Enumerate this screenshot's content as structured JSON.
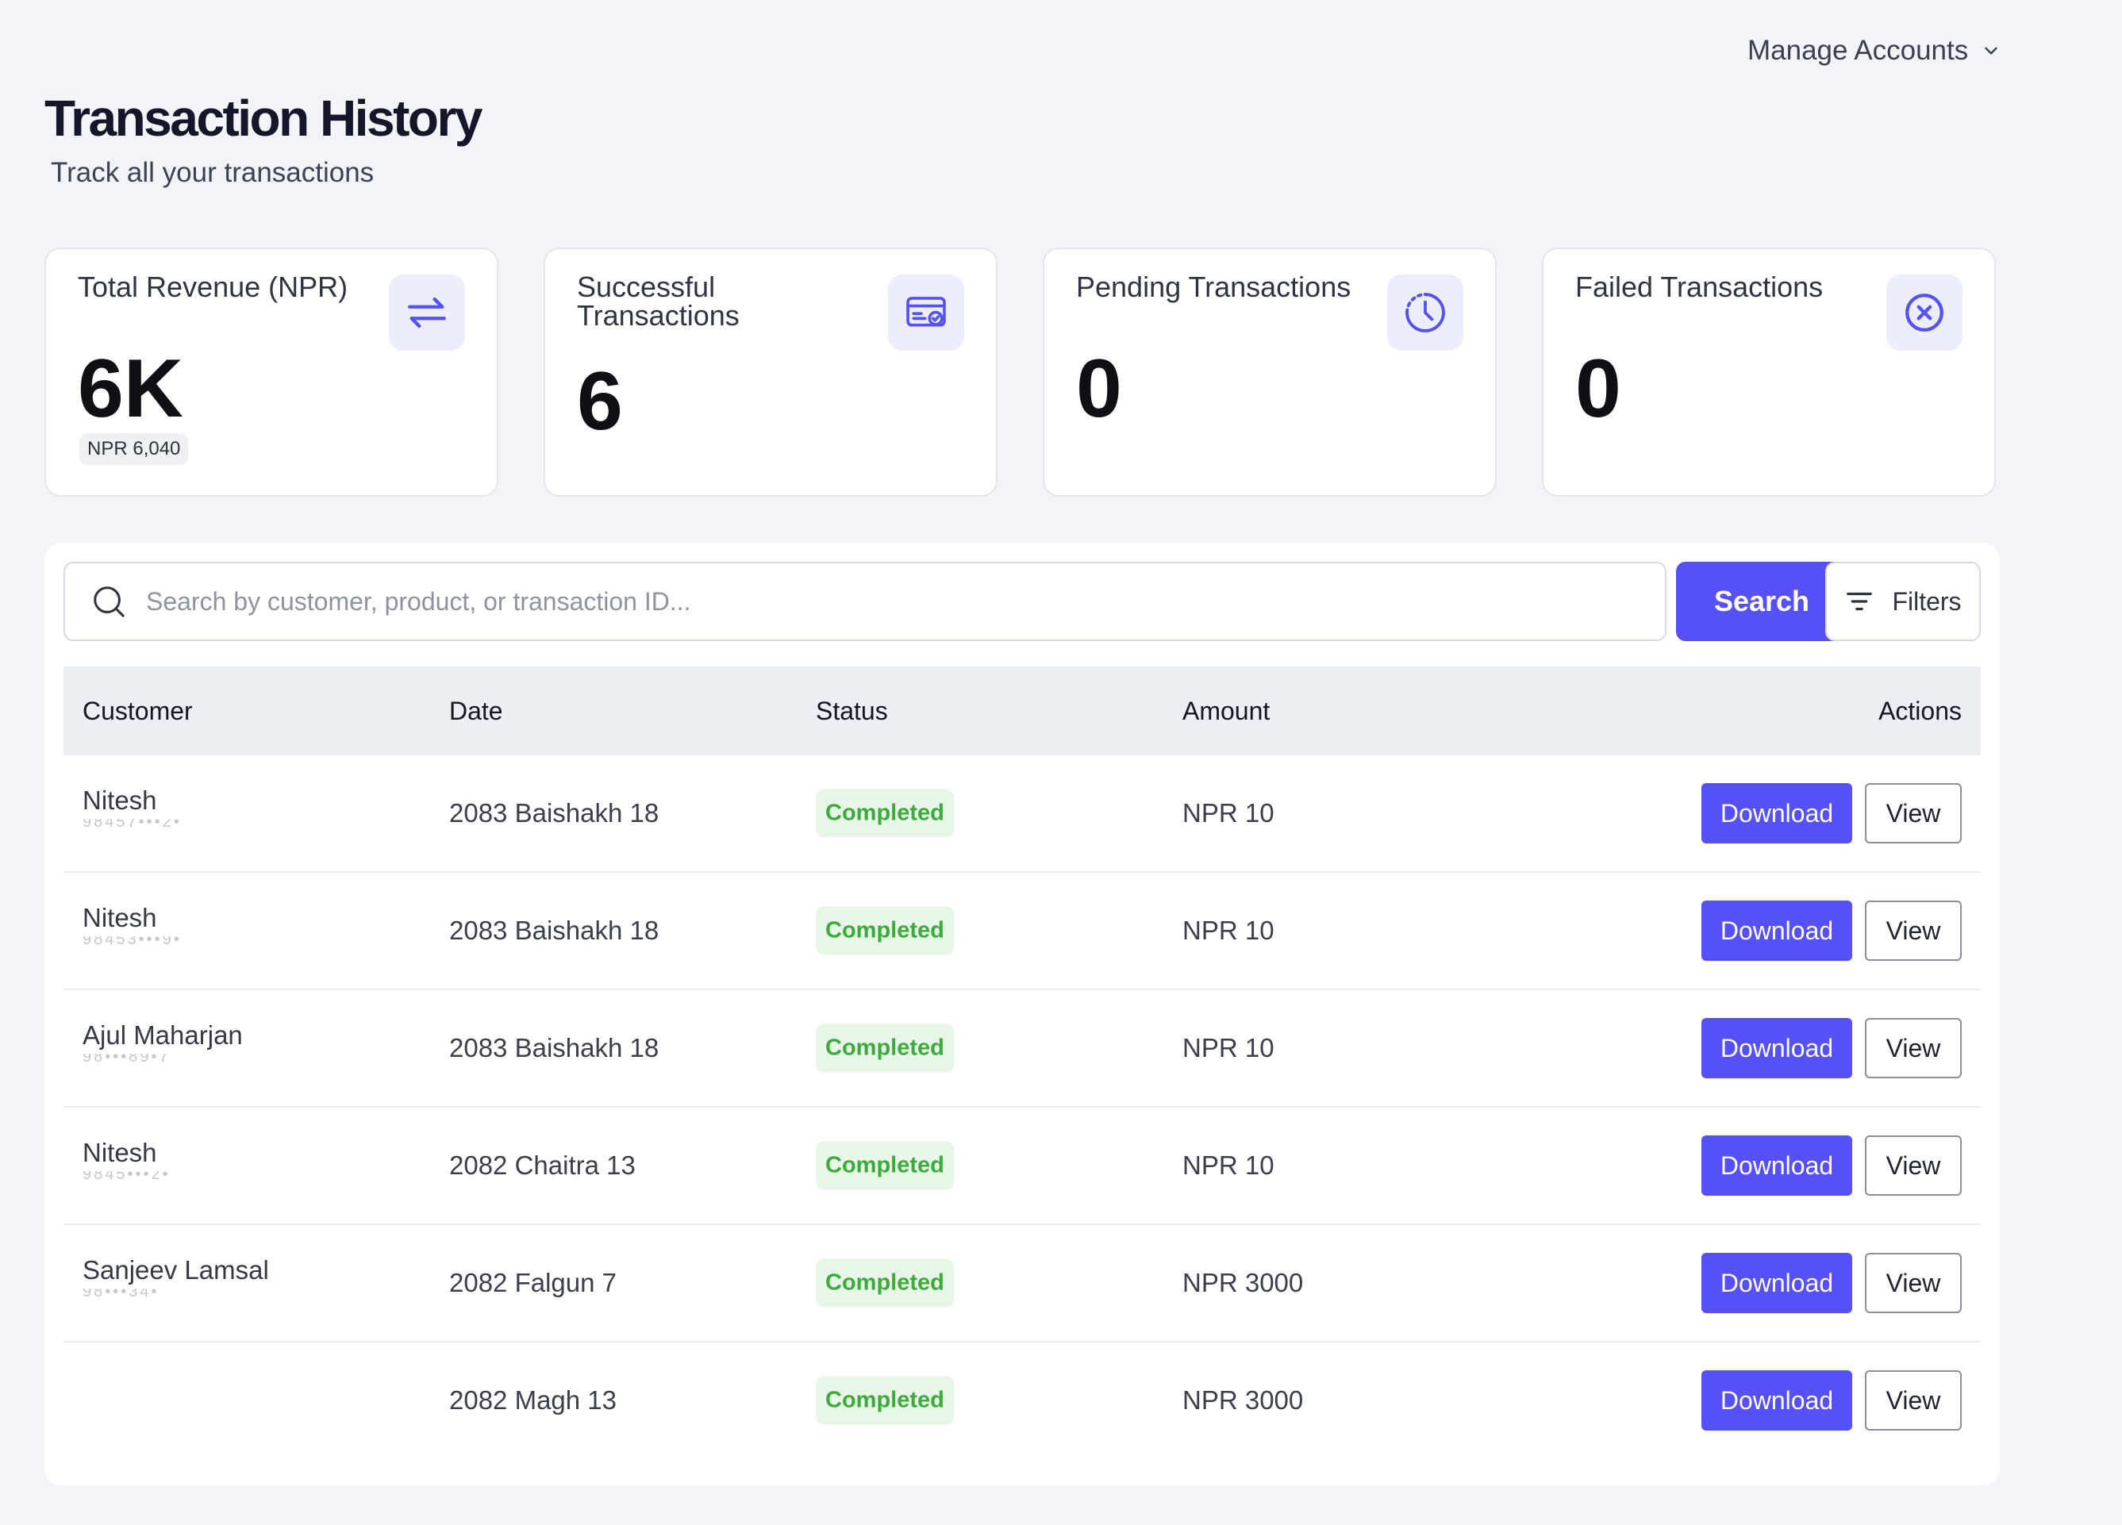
{
  "header": {
    "manage_accounts": "Manage Accounts",
    "title": "Transaction History",
    "subtitle": "Track all your transactions"
  },
  "stats": [
    {
      "label": "Total Revenue (NPR)",
      "value": "6K",
      "chip": "NPR 6,040",
      "icon": "transfer-arrows-icon"
    },
    {
      "label": "Successful Transactions",
      "value": "6",
      "icon": "card-check-icon"
    },
    {
      "label": "Pending Transactions",
      "value": "0",
      "icon": "clock-icon"
    },
    {
      "label": "Failed Transactions",
      "value": "0",
      "icon": "x-circle-icon"
    }
  ],
  "search": {
    "placeholder": "Search by customer, product, or transaction ID...",
    "button_label": "Search",
    "filters_label": "Filters"
  },
  "table": {
    "columns": [
      "Customer",
      "Date",
      "Status",
      "Amount",
      "Actions"
    ],
    "rows": [
      {
        "customer": "Nitesh",
        "phone": "98457•••2•",
        "date": "2083 Baishakh 18",
        "status": "Completed",
        "amount": "NPR 10"
      },
      {
        "customer": "Nitesh",
        "phone": "98453•••9•",
        "date": "2083 Baishakh 18",
        "status": "Completed",
        "amount": "NPR 10"
      },
      {
        "customer": "Ajul Maharjan",
        "phone": "98•••89•7",
        "date": "2083 Baishakh 18",
        "status": "Completed",
        "amount": "NPR 10"
      },
      {
        "customer": "Nitesh",
        "phone": "9845•••2•",
        "date": "2082 Chaitra 13",
        "status": "Completed",
        "amount": "NPR 10"
      },
      {
        "customer": "Sanjeev Lamsal",
        "phone": "98•••34•",
        "date": "2082 Falgun 7",
        "status": "Completed",
        "amount": "NPR 3000"
      },
      {
        "customer": "",
        "phone": "",
        "date": "2082 Magh 13",
        "status": "Completed",
        "amount": "NPR 3000"
      }
    ],
    "download_label": "Download",
    "view_label": "View"
  },
  "colors": {
    "accent": "#5650f7",
    "success_text": "#3caa3c",
    "success_bg": "#e7f6e7",
    "icon_bg": "#eceefd"
  }
}
